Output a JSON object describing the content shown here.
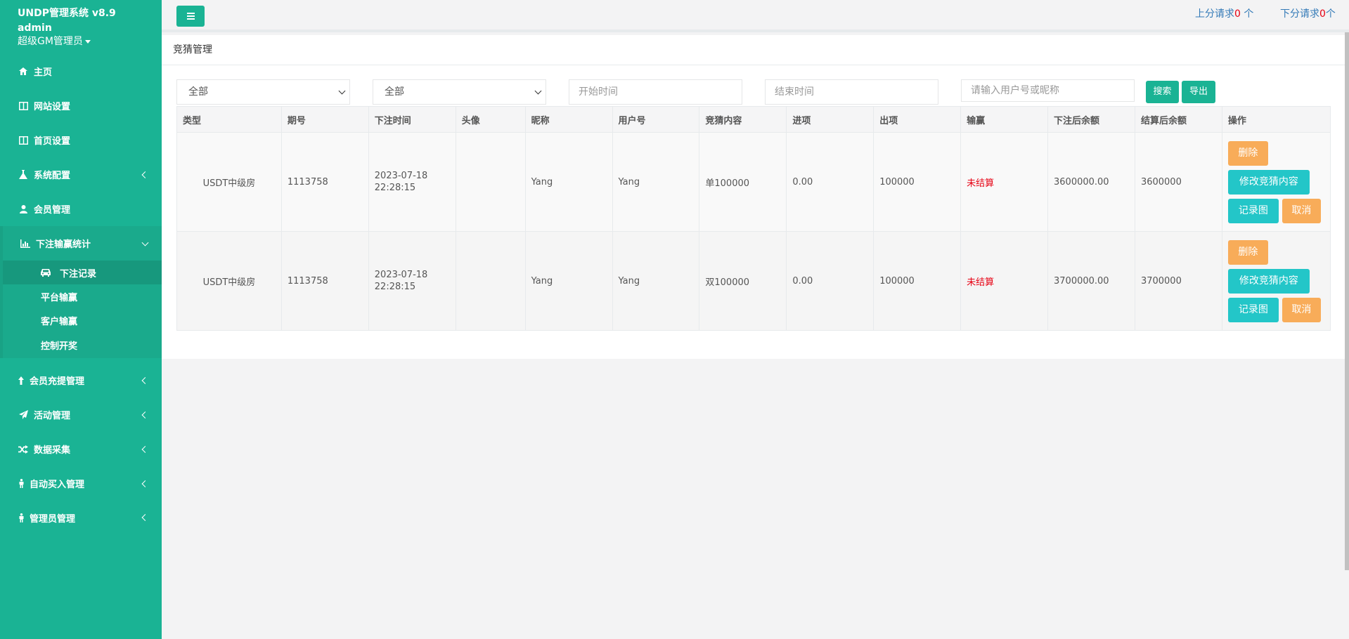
{
  "sidebar": {
    "app_title": "UNDP管理系统 v8.9",
    "username": "admin",
    "role": "超级GM管理员",
    "items": [
      {
        "label": "主页",
        "icon": "home-icon"
      },
      {
        "label": "网站设置",
        "icon": "columns-icon"
      },
      {
        "label": "首页设置",
        "icon": "columns-icon"
      },
      {
        "label": "系统配置",
        "icon": "flask-icon"
      },
      {
        "label": "会员管理",
        "icon": "user-icon"
      },
      {
        "label": "下注输赢统计",
        "icon": "bar-chart-icon"
      },
      {
        "label": "会员充提管理",
        "icon": "upload-icon"
      },
      {
        "label": "活动管理",
        "icon": "paper-plane-icon"
      },
      {
        "label": "数据采集",
        "icon": "random-icon"
      },
      {
        "label": "自动买入管理",
        "icon": "male-icon"
      },
      {
        "label": "管理员管理",
        "icon": "male-icon"
      }
    ],
    "sub_items": [
      {
        "label": "下注记录",
        "icon": "car-icon"
      },
      {
        "label": "平台输赢"
      },
      {
        "label": "客户输赢"
      },
      {
        "label": "控制开奖"
      }
    ]
  },
  "topbar": {
    "up_prefix": "上分请求",
    "up_count": "0",
    "up_suffix": " 个",
    "down_prefix": "下分请求",
    "down_count": "0",
    "down_suffix": "个"
  },
  "panel": {
    "title": "竞猜管理",
    "filter1": "全部",
    "filter2": "全部",
    "start_placeholder": "开始时间",
    "end_placeholder": "结束时间",
    "search_placeholder": "请输入用户号或昵称",
    "search_btn": "搜索",
    "export_btn": "导出"
  },
  "table": {
    "headers": [
      "类型",
      "期号",
      "下注时间",
      "头像",
      "昵称",
      "用户号",
      "竞猜内容",
      "进项",
      "出项",
      "输赢",
      "下注后余额",
      "结算后余额",
      "操作"
    ],
    "rows": [
      {
        "type": "USDT中级房",
        "issue": "1113758",
        "date": "2023-07-18",
        "time": "22:28:15",
        "avatar": "",
        "nickname": "Yang",
        "user_no": "Yang",
        "content": "单100000",
        "income": "0.00",
        "outgo": "100000",
        "result": "未结算",
        "bal_after_bet": "3600000.00",
        "bal_after_settle": "3600000"
      },
      {
        "type": "USDT中级房",
        "issue": "1113758",
        "date": "2023-07-18",
        "time": "22:28:15",
        "avatar": "",
        "nickname": "Yang",
        "user_no": "Yang",
        "content": "双100000",
        "income": "0.00",
        "outgo": "100000",
        "result": "未结算",
        "bal_after_bet": "3700000.00",
        "bal_after_settle": "3700000"
      }
    ],
    "actions": {
      "delete": "删除",
      "modify": "修改竞猜内容",
      "record": "记录图",
      "cancel": "取消"
    }
  },
  "colors": {
    "brand": "#1ab394",
    "warn": "#f8ac59",
    "info": "#23c6c8",
    "danger": "#e60012"
  }
}
